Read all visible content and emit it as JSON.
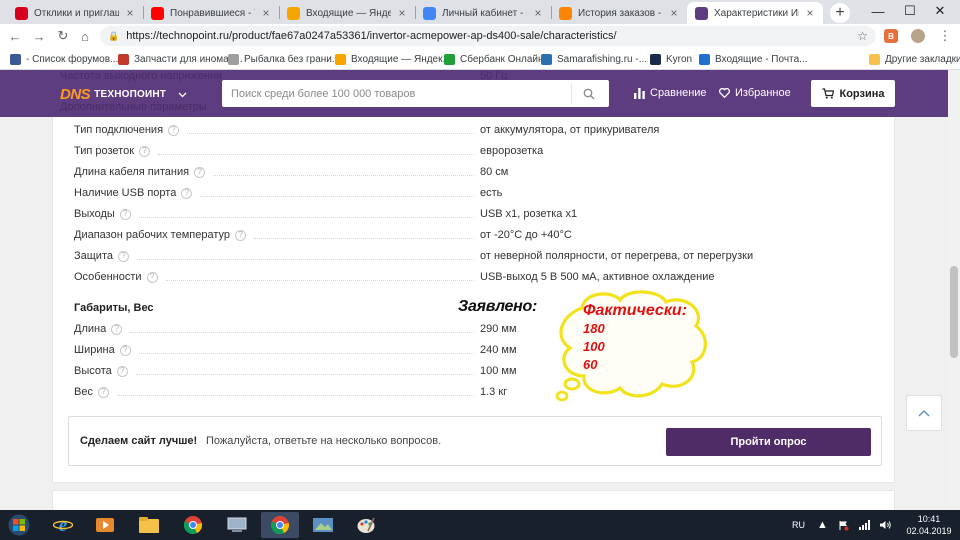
{
  "browser": {
    "tabs": [
      {
        "title": "Отклики и приглашени",
        "icon": "hh-icon",
        "color": "#d6001c",
        "active": false
      },
      {
        "title": "Понравившиеся - YouT",
        "icon": "youtube-icon",
        "color": "#ff0000",
        "active": false
      },
      {
        "title": "Входящие — Яндекс.По",
        "icon": "yandex-mail-icon",
        "color": "#f7a600",
        "active": false
      },
      {
        "title": "Личный кабинет - Мои",
        "icon": "google-apps-icon",
        "color": "#4285f4",
        "active": false
      },
      {
        "title": "История заказов - DNS",
        "icon": "dns-orange-icon",
        "color": "#fc8507",
        "active": false
      },
      {
        "title": "Характеристики Инвер",
        "icon": "dns-site-icon",
        "color": "#5e3c80",
        "active": true
      }
    ],
    "new_tab": "+",
    "window_controls": {
      "minimize": "—",
      "maximize": "☐",
      "close": "✕"
    },
    "url": "https://technopoint.ru/product/fae67a0247a53361/invertor-acmepower-ap-ds400-sale/characteristics/",
    "bookmarks": [
      {
        "label": "- Список форумов...",
        "icon": "forum-icon",
        "color": "#3b5998"
      },
      {
        "label": "Запчасти для иномар...",
        "icon": "parts-icon",
        "color": "#c0392b"
      },
      {
        "label": "Рыбалка без грани...",
        "icon": "page-icon",
        "color": "#9e9e9e"
      },
      {
        "label": "Входящие — Яндек...",
        "icon": "yandex-mail-icon",
        "color": "#f7a600"
      },
      {
        "label": "Сбербанк Онлайн",
        "icon": "sberbank-icon",
        "color": "#21a038"
      },
      {
        "label": "Samarafishing.ru -...",
        "icon": "fish-icon",
        "color": "#2a6fb0"
      },
      {
        "label": "Kyron",
        "icon": "kyron-icon",
        "color": "#1b2a4a"
      },
      {
        "label": "Входящие - Почтa...",
        "icon": "mail-icon",
        "color": "#1f6fcf"
      },
      {
        "label": "Другие закладки",
        "icon": "folder-icon",
        "color": "#f4c24a"
      }
    ]
  },
  "site_header": {
    "logo_dns": "DNS",
    "logo_text": "ТЕХНОПОИНТ",
    "search_placeholder": "Поиск среди более 100 000 товаров",
    "compare_label": "Сравнение",
    "favorites_label": "Избранное",
    "cart_label": "Корзина",
    "ghost_text_1": "Частота выходного напряжения",
    "ghost_text_1_value": "50 Гц",
    "ghost_text_2": "Дополнительные параметры"
  },
  "specs": {
    "additional": [
      {
        "name": "Тип подключения",
        "value": "от аккумулятора, от прикуривателя"
      },
      {
        "name": "Тип розеток",
        "value": "евророзетка"
      },
      {
        "name": "Длина кабеля питания",
        "value": "80 см"
      },
      {
        "name": "Наличие USB порта",
        "value": "есть"
      },
      {
        "name": "Выходы",
        "value": "USB x1, розетка x1"
      },
      {
        "name": "Диапазон рабочих температур",
        "value": "от -20°C до +40°C"
      },
      {
        "name": "Защита",
        "value": "от неверной полярности, от перегрева, от перегрузки"
      },
      {
        "name": "Особенности",
        "value": "USB-выход 5 В 500 мА, активное охлаждение"
      }
    ],
    "dimensions_heading": "Габариты, Вес",
    "dimensions": [
      {
        "name": "Длина",
        "value": "290 мм"
      },
      {
        "name": "Ширина",
        "value": "240 мм"
      },
      {
        "name": "Высота",
        "value": "100 мм"
      },
      {
        "name": "Вес",
        "value": "1.3 кг"
      }
    ]
  },
  "survey": {
    "title": "Сделаем сайт лучше!",
    "text": "Пожалуйста, ответьте на несколько вопросов.",
    "button": "Пройти опрос"
  },
  "annotation": {
    "claimed_label": "Заявлено:",
    "actual_label": "Фактически:",
    "actual_values": [
      "180",
      "100",
      "60"
    ]
  },
  "taskbar": {
    "language": "RU",
    "time": "10:41",
    "date": "02.04.2019"
  }
}
